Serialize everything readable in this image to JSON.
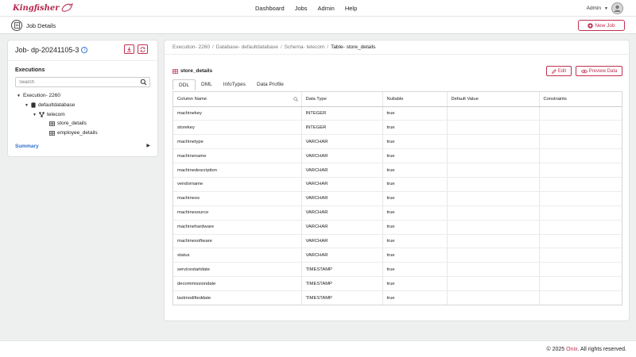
{
  "app": {
    "name": "Kingfisher"
  },
  "nav": {
    "links": [
      "Dashboard",
      "Jobs",
      "Admin",
      "Help"
    ]
  },
  "user": {
    "name": "Admin"
  },
  "header": {
    "title": "Job Details",
    "new_job_label": "New Job"
  },
  "job": {
    "title": "Job- dp-20241105-3",
    "info_glyph": "i"
  },
  "executions": {
    "label": "Executions",
    "search_placeholder": "Search",
    "tree": {
      "execution": "Execution- 2260",
      "database": "defaultdatabase",
      "schema": "telecom",
      "tables": [
        "store_details",
        "employee_details"
      ]
    },
    "summary_label": "Summary"
  },
  "breadcrumb": {
    "items": [
      "Execution- 2260",
      "Database- defaultdatabase",
      "Schema- telecom",
      "Table- store_details"
    ],
    "separator": "/"
  },
  "table_view": {
    "name": "store_details",
    "edit_label": "Edit",
    "preview_label": "Preview Data",
    "tabs": [
      "DDL",
      "DML",
      "InfoTypes",
      "Data Profile"
    ],
    "active_tab": "DDL",
    "columns": [
      "Column Name",
      "Data Type",
      "Nullable",
      "Default Value",
      "Constraints"
    ],
    "rows": [
      [
        "machinekey",
        "INTEGER",
        "true",
        "",
        ""
      ],
      [
        "storekey",
        "INTEGER",
        "true",
        "",
        ""
      ],
      [
        "machinetype",
        "VARCHAR",
        "true",
        "",
        ""
      ],
      [
        "machinename",
        "VARCHAR",
        "true",
        "",
        ""
      ],
      [
        "machinedescription",
        "VARCHAR",
        "true",
        "",
        ""
      ],
      [
        "vendorname",
        "VARCHAR",
        "true",
        "",
        ""
      ],
      [
        "machineos",
        "VARCHAR",
        "true",
        "",
        ""
      ],
      [
        "machinesource",
        "VARCHAR",
        "true",
        "",
        ""
      ],
      [
        "machinehardware",
        "VARCHAR",
        "true",
        "",
        ""
      ],
      [
        "machinesoftware",
        "VARCHAR",
        "true",
        "",
        ""
      ],
      [
        "status",
        "VARCHAR",
        "true",
        "",
        ""
      ],
      [
        "servicestartdate",
        "TIMESTAMP",
        "true",
        "",
        ""
      ],
      [
        "decommissiondate",
        "TIMESTAMP",
        "true",
        "",
        ""
      ],
      [
        "lastmodifieddate",
        "TIMESTAMP",
        "true",
        "",
        ""
      ]
    ]
  },
  "footer": {
    "prefix": "© 2025 ",
    "brand": "Onix",
    "suffix": ". All rights reserved."
  },
  "colors": {
    "accent": "#c0304f",
    "brand": "#b5294e",
    "link": "#2d6fd0"
  },
  "icons": [
    "bird-logo-icon",
    "user-avatar-icon",
    "document-icon",
    "plus-circle-icon",
    "info-icon",
    "download-icon",
    "refresh-icon",
    "search-icon",
    "database-icon",
    "schema-icon",
    "table-icon",
    "pencil-icon",
    "eye-icon"
  ]
}
